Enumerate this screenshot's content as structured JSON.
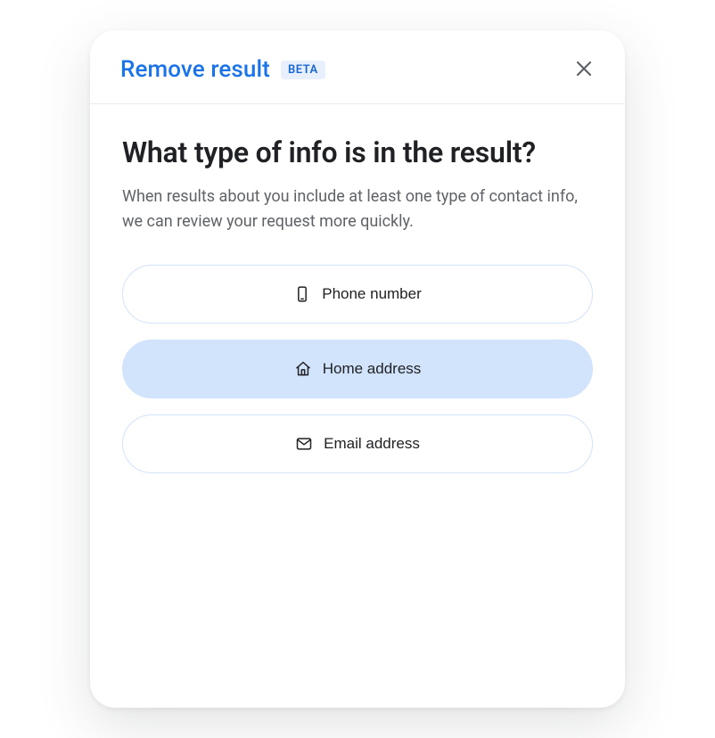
{
  "header": {
    "title": "Remove result",
    "badge": "BETA"
  },
  "main": {
    "heading": "What type of info is in the result?",
    "subtext": "When results about you include at least one type of contact info, we can review your request more quickly."
  },
  "options": [
    {
      "id": "phone",
      "label": "Phone number",
      "icon": "phone-icon",
      "selected": false
    },
    {
      "id": "home",
      "label": "Home address",
      "icon": "home-icon",
      "selected": true
    },
    {
      "id": "email",
      "label": "Email address",
      "icon": "email-icon",
      "selected": false
    }
  ],
  "colors": {
    "accent": "#1a73e8",
    "badge_bg": "#e8f0fe",
    "option_selected_bg": "#d2e3fc"
  }
}
